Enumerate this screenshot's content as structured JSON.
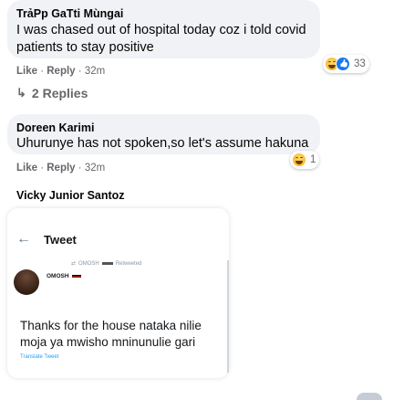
{
  "colors": {
    "bubble_bg": "#f0f2f5",
    "meta_text": "#65676b",
    "link": "#1da1f2"
  },
  "comments": [
    {
      "author": "TrảPp GaTti Mùngai",
      "text": "I was chased out of hospital today coz i told covid patients to stay positive",
      "like": "Like",
      "reply": "Reply",
      "time": "32m",
      "reactions": [
        "haha",
        "like"
      ],
      "reaction_count": "33",
      "replies": "2 Replies",
      "replies_icon": "reply-arrow-icon"
    },
    {
      "author": "Doreen Karimi",
      "text": "Uhurunye has not spoken,so let's assume hakuna",
      "like": "Like",
      "reply": "Reply",
      "time": "32m",
      "reactions": [
        "haha"
      ],
      "reaction_count": "1"
    },
    {
      "author": "Vicky Junior Santoz"
    }
  ],
  "tweet": {
    "back_icon": "back-arrow-icon",
    "header": "Tweet",
    "retweeted_by": "OMOSH",
    "retweeted_label": "Retweeted",
    "handle": "OMOSH",
    "text": "Thanks for the house nataka nilie moja ya mwisho mninunulie gari",
    "translate": "Translate Tweet"
  }
}
